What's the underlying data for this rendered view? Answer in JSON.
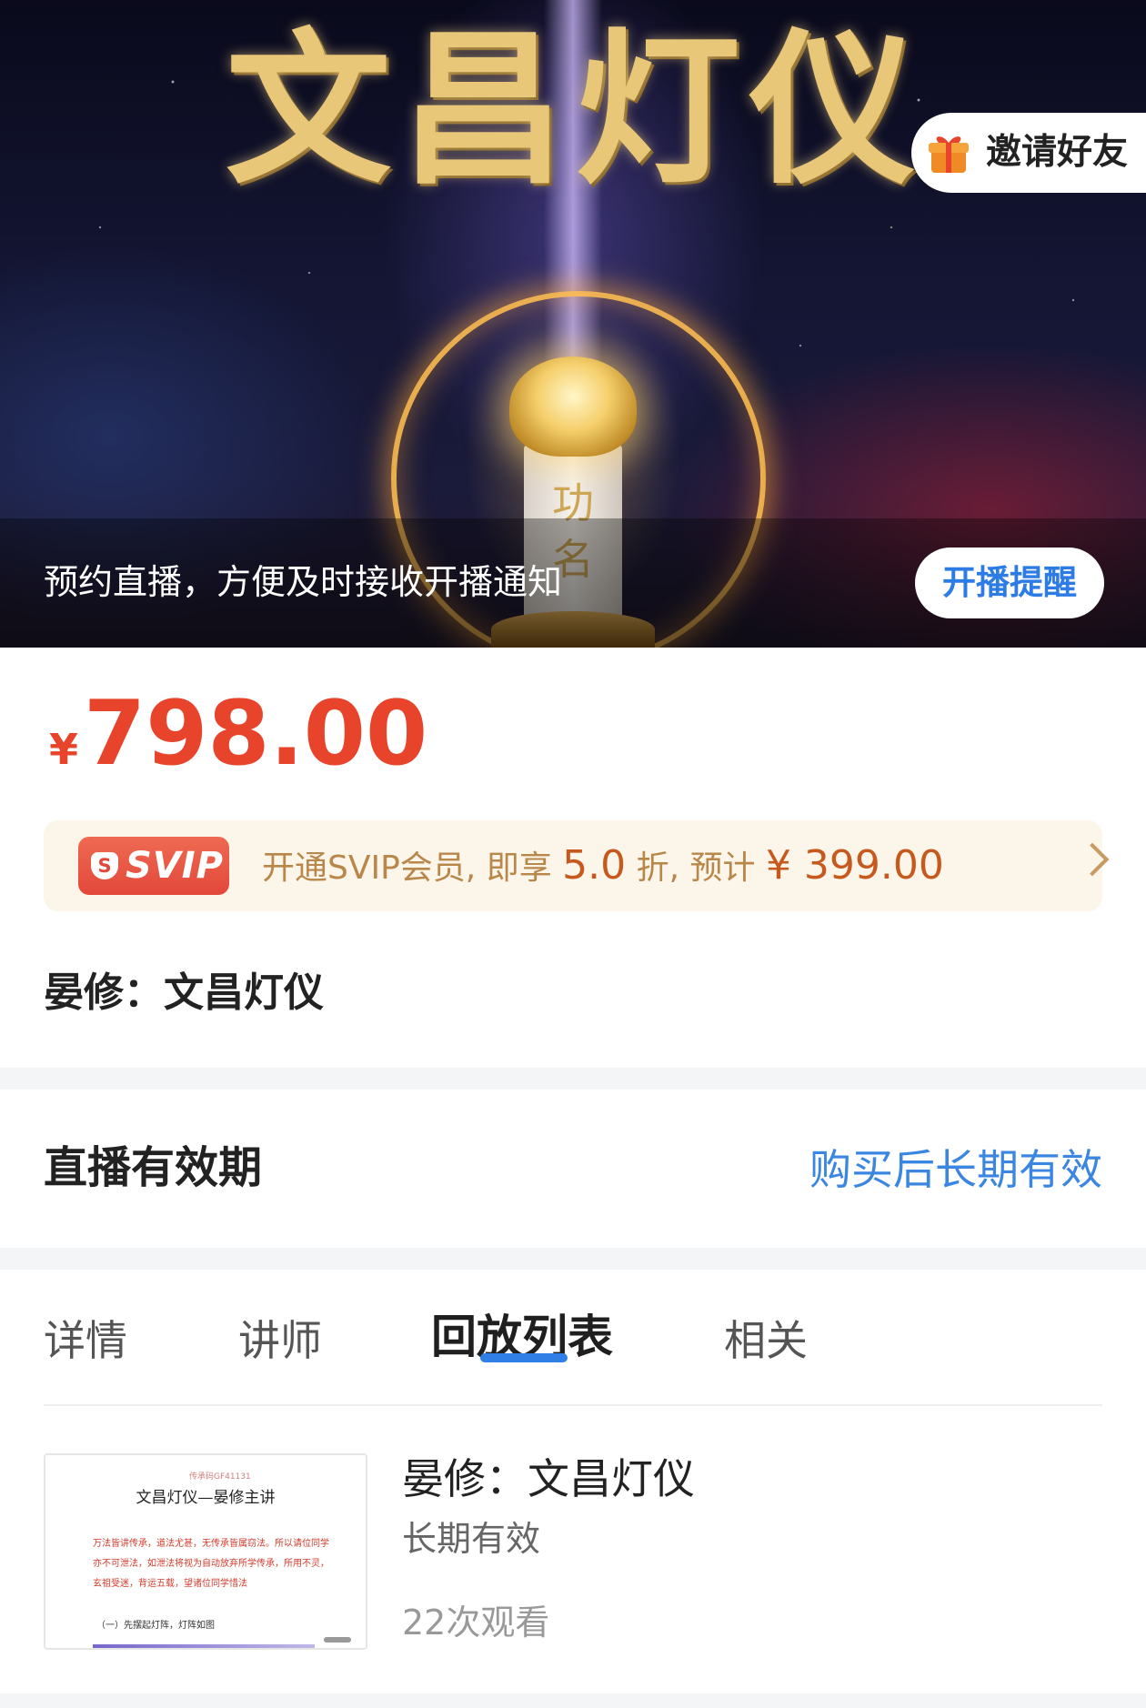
{
  "banner": {
    "title": "文昌灯仪",
    "tablet_text": "功名",
    "invite_label": "邀请好友",
    "reserve_message": "预约直播，方便及时接收开播通知",
    "remind_button": "开播提醒"
  },
  "price": {
    "currency": "¥",
    "amount": "798.00"
  },
  "svip": {
    "badge_icon_text": "S",
    "badge_text": "SVIP",
    "promo_prefix": "开通SVIP会员, 即享",
    "discount": "5.0",
    "promo_middle": "折, 预计",
    "estimated_price": "¥ 399.00"
  },
  "course": {
    "title": "晏修：文昌灯仪"
  },
  "validity": {
    "label": "直播有效期",
    "value": "购买后长期有效"
  },
  "tabs": [
    {
      "label": "详情"
    },
    {
      "label": "讲师"
    },
    {
      "label": "回放列表"
    },
    {
      "label": "相关"
    }
  ],
  "active_tab": "回放列表",
  "replay": {
    "thumbnail": {
      "code": "传承码GF41131",
      "title": "文昌灯仪—晏修主讲",
      "lines": [
        "万法皆讲传承，道法尤甚，无传承皆属窃法。所以请位同学",
        "亦不可泄法，如泄法将视为自动放弃所学传承，所用不灵，",
        "玄祖受迷，背运五载，望诸位同学惜法"
      ],
      "section": "（一）先摆起灯阵，灯阵如图"
    },
    "title": "晏修：文昌灯仪",
    "validity": "长期有效",
    "views": "22次观看"
  },
  "colors": {
    "price_red": "#e8432b",
    "link_blue": "#3a86e0",
    "svip_badge": "#e2483a",
    "svip_bg": "#fcf5e9",
    "promo_text": "#b9874a",
    "tab_indicator": "#2f7fe6"
  }
}
